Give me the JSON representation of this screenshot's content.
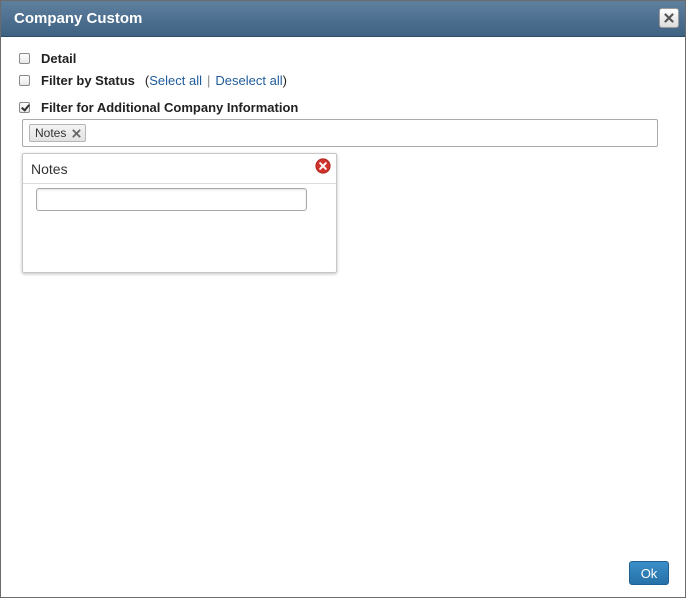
{
  "dialog": {
    "title": "Company Custom",
    "close_icon": "close-icon"
  },
  "options": {
    "detail": {
      "label": "Detail",
      "checked": false
    },
    "filter_by_status": {
      "label": "Filter by Status",
      "checked": false,
      "paren_open": "(",
      "select_all": "Select all",
      "separator": "|",
      "deselect_all": "Deselect all",
      "paren_close": ")"
    },
    "filter_additional": {
      "label": "Filter for Additional Company Information",
      "checked": true
    }
  },
  "tags": [
    {
      "label": "Notes",
      "remove_icon": "remove-x-icon"
    }
  ],
  "notes_panel": {
    "title": "Notes",
    "remove_icon": "remove-circle-icon",
    "input_value": "",
    "input_placeholder": ""
  },
  "footer": {
    "ok_label": "Ok",
    "accent_color": "#2e7ab6"
  }
}
